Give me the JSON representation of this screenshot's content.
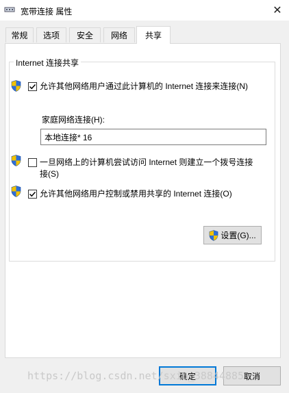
{
  "window": {
    "title": "宽带连接 属性",
    "close_glyph": "✕"
  },
  "tabs": [
    {
      "label": "常规",
      "active": false
    },
    {
      "label": "选项",
      "active": false
    },
    {
      "label": "安全",
      "active": false
    },
    {
      "label": "网络",
      "active": false
    },
    {
      "label": "共享",
      "active": true
    }
  ],
  "sharing": {
    "group_title": "Internet 连接共享",
    "allow_others": {
      "label": "允许其他网络用户通过此计算机的 Internet 连接来连接(N)",
      "checked": true
    },
    "home_network_label": "家庭网络连接(H):",
    "home_network_value": "本地连接* 16",
    "dial_on_demand": {
      "label_line1": "一旦网络上的计算机尝试访问 Internet 则建立一个拨号连接",
      "label_line2": "接(S)",
      "checked": false
    },
    "allow_control": {
      "label": "允许其他网络用户控制或禁用共享的 Internet 连接(O)",
      "checked": true
    },
    "settings_button": "设置(G)..."
  },
  "footer": {
    "ok": "确定",
    "cancel": "取消"
  },
  "watermark": "https://blog.csdn.net/sxin_38844885",
  "colors": {
    "dialog_bg": "#f0f0f0",
    "accent": "#0078d7",
    "shield_blue": "#2f6fd6",
    "shield_yellow": "#f2c200"
  },
  "icons": {
    "title": "network-connection-icon",
    "shield": "uac-shield-icon",
    "check": "checkmark-icon"
  }
}
